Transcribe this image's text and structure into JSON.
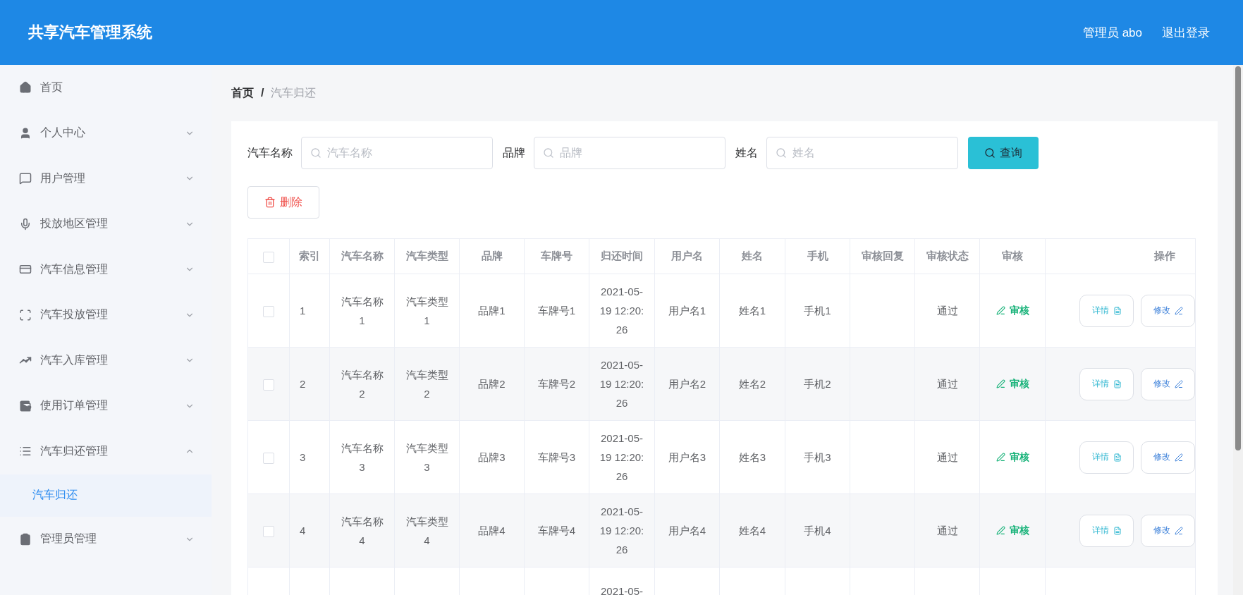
{
  "header": {
    "title": "共享汽车管理系统",
    "user": "管理员 abo",
    "logout": "退出登录"
  },
  "sidebar": {
    "items": [
      {
        "label": "首页"
      },
      {
        "label": "个人中心",
        "expanded": false
      },
      {
        "label": "用户管理",
        "expanded": false
      },
      {
        "label": "投放地区管理",
        "expanded": false
      },
      {
        "label": "汽车信息管理",
        "expanded": false
      },
      {
        "label": "汽车投放管理",
        "expanded": false
      },
      {
        "label": "汽车入库管理",
        "expanded": false
      },
      {
        "label": "使用订单管理",
        "expanded": false
      },
      {
        "label": "汽车归还管理",
        "expanded": true,
        "children": [
          {
            "label": "汽车归还",
            "selected": true
          }
        ]
      },
      {
        "label": "管理员管理",
        "expanded": false
      }
    ]
  },
  "breadcrumb": {
    "items": [
      "首页",
      "汽车归还"
    ],
    "separator": "/"
  },
  "search": {
    "fields": [
      {
        "label": "汽车名称",
        "placeholder": "汽车名称"
      },
      {
        "label": "品牌",
        "placeholder": "品牌"
      },
      {
        "label": "姓名",
        "placeholder": "姓名"
      }
    ],
    "button": "查询"
  },
  "delete_button": "删除",
  "table": {
    "all_checked": false,
    "columns": [
      "索引",
      "汽车名称",
      "汽车类型",
      "品牌",
      "车牌号",
      "归还时间",
      "用户名",
      "姓名",
      "手机",
      "审核回复",
      "审核状态",
      "审核",
      "操作"
    ],
    "rows": [
      {
        "checked": false,
        "cells": [
          "1",
          "汽车名称1",
          "汽车类型1",
          "品牌1",
          "车牌号1",
          "2021-05-19 12:20:26",
          "用户名1",
          "姓名1",
          "手机1",
          null,
          "通过"
        ],
        "review_link": "审核",
        "actions": [
          "详情",
          "修改"
        ]
      },
      {
        "checked": false,
        "cells": [
          "2",
          "汽车名称2",
          "汽车类型2",
          "品牌2",
          "车牌号2",
          "2021-05-19 12:20:26",
          "用户名2",
          "姓名2",
          "手机2",
          null,
          "通过"
        ],
        "review_link": "审核",
        "actions": [
          "详情",
          "修改"
        ]
      },
      {
        "checked": false,
        "cells": [
          "3",
          "汽车名称3",
          "汽车类型3",
          "品牌3",
          "车牌号3",
          "2021-05-19 12:20:26",
          "用户名3",
          "姓名3",
          "手机3",
          null,
          "通过"
        ],
        "review_link": "审核",
        "actions": [
          "详情",
          "修改"
        ]
      },
      {
        "checked": false,
        "cells": [
          "4",
          "汽车名称4",
          "汽车类型4",
          "品牌4",
          "车牌号4",
          "2021-05-19 12:20:26",
          "用户名4",
          "姓名4",
          "手机4",
          null,
          "通过"
        ],
        "review_link": "审核",
        "actions": [
          "详情",
          "修改"
        ]
      },
      {
        "cells": [
          null,
          null,
          null,
          null,
          null,
          "2021-05-",
          null,
          null,
          null,
          null,
          null
        ]
      }
    ]
  }
}
